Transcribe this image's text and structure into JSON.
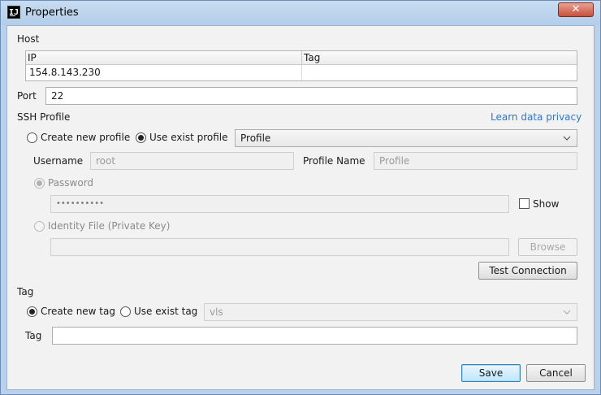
{
  "window": {
    "title": "Properties",
    "app_icon_text": "IJ",
    "close_label": "✕"
  },
  "host": {
    "section_label": "Host",
    "table": {
      "headers": [
        "IP",
        "Tag"
      ],
      "rows": [
        [
          "154.8.143.230",
          ""
        ]
      ]
    }
  },
  "port": {
    "label": "Port",
    "value": "22"
  },
  "ssh_profile": {
    "section_label": "SSH Profile",
    "privacy_link": "Learn data privacy",
    "create_new_label": "Create new profile",
    "use_exist_label": "Use exist profile",
    "selected_mode": "use_exist",
    "profile_select_value": "Profile",
    "username_label": "Username",
    "username_value": "root",
    "profile_name_label": "Profile Name",
    "profile_name_value": "Profile",
    "password_label": "Password",
    "password_value": "••••••••••",
    "show_label": "Show",
    "identity_label": "Identity File (Private Key)",
    "identity_value": "",
    "browse_label": "Browse",
    "test_connection_label": "Test Connection"
  },
  "tag": {
    "section_label": "Tag",
    "create_new_label": "Create new tag",
    "use_exist_label": "Use exist tag",
    "selected_mode": "create_new",
    "exist_select_value": "vls",
    "field_label": "Tag",
    "field_value": ""
  },
  "footer": {
    "save_label": "Save",
    "cancel_label": "Cancel"
  },
  "colors": {
    "accent": "#2f77c8",
    "title_bar": "#b9d1ea",
    "close": "#c7503d",
    "panel": "#f2f2f2"
  }
}
